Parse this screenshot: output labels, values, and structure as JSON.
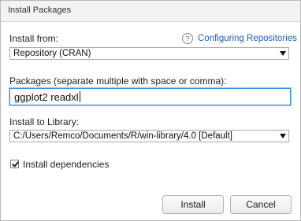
{
  "window": {
    "title": "Install Packages"
  },
  "install_from": {
    "label": "Install from:",
    "value": "Repository (CRAN)"
  },
  "help": {
    "icon": "?",
    "link_text": "Configuring Repositories"
  },
  "packages": {
    "label": "Packages (separate multiple with space or comma):",
    "value": "ggplot2 readxl"
  },
  "library": {
    "label": "Install to Library:",
    "value": "C:/Users/Remco/Documents/R/win-library/4.0 [Default]"
  },
  "dependencies": {
    "label": "Install dependencies",
    "checked": true
  },
  "buttons": {
    "install": "Install",
    "cancel": "Cancel"
  }
}
